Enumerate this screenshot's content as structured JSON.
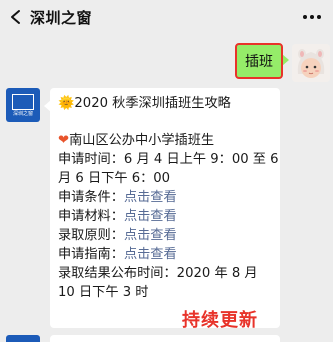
{
  "header": {
    "back_icon": "chevron-left-icon",
    "title": "深圳之窗",
    "more_icon": "ellipsis-icon"
  },
  "sent_message": {
    "text": "插班",
    "bubble_color": "#95ec69",
    "highlight_border": "#e8332a"
  },
  "reply": {
    "avatar_label": "深圳之窗",
    "heading_emoji": "🌞",
    "heading": "2020 秋季深圳插班生攻略",
    "section_emoji": "❤",
    "section": "南山区公办中小学插班生",
    "time_line_1": "申请时间：6 月 4 日上午 9：00 至 6",
    "time_line_2": "月 6 日下午 6：00",
    "rows": [
      {
        "label": "申请条件：",
        "link": "点击查看"
      },
      {
        "label": "申请材料：",
        "link": "点击查看"
      },
      {
        "label": "录取原则：",
        "link": "点击查看"
      },
      {
        "label": "申请指南：",
        "link": "点击查看"
      }
    ],
    "result_line_1": "录取结果公布时间：2020 年 8 月",
    "result_line_2": "10 日下午 3 时",
    "link_color": "#576b95"
  },
  "overlay": {
    "text": "持续更新",
    "color": "#e8332a"
  }
}
